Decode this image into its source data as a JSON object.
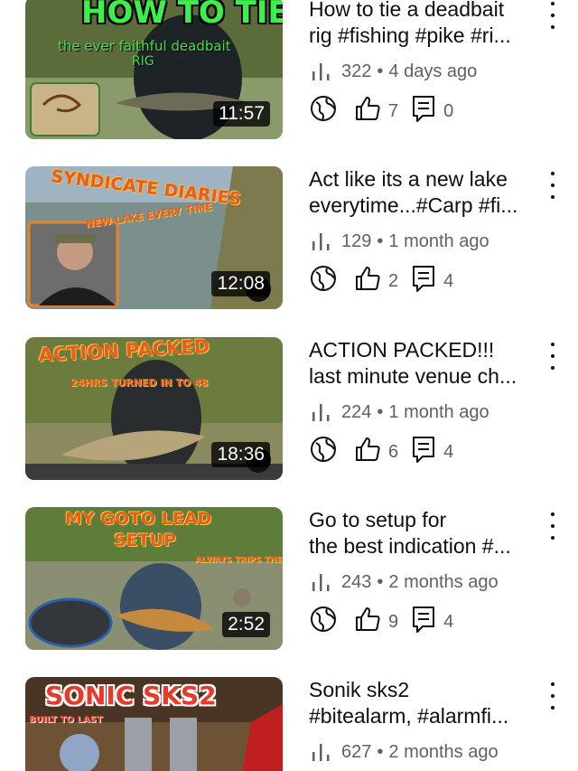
{
  "videos": [
    {
      "thumb_text": "HOW TO TIE...",
      "thumb_subtext": "the ever faithful deadbait",
      "thumb_subtext2": "RIG",
      "duration": "11:57",
      "title_line1": "How to tie a deadbait",
      "title_line2": "rig #fishing #pike #ri...",
      "views": "322",
      "age": "4 days ago",
      "likes": "7",
      "comments": "0"
    },
    {
      "thumb_text": "SYNDICATE DIARIES",
      "thumb_subtext": "NEW LAKE EVERY TIME",
      "duration": "12:08",
      "title_line1": "Act like its a new lake",
      "title_line2": "everytime...#Carp #fi...",
      "views": "129",
      "age": "1 month ago",
      "likes": "2",
      "comments": "4"
    },
    {
      "thumb_text": "ACTION PACKED",
      "thumb_subtext": "24HRS TURNED IN TO 48",
      "duration": "18:36",
      "title_line1": "ACTION PACKED!!!",
      "title_line2": "last minute venue ch...",
      "views": "224",
      "age": "1 month ago",
      "likes": "6",
      "comments": "4"
    },
    {
      "thumb_text": "MY GOTO LEAD",
      "thumb_text2": "SETUP",
      "thumb_subtext": "ALWAYS TRIPS THEM UP",
      "duration": "2:52",
      "title_line1": "Go to setup for",
      "title_line2": "the best indication #...",
      "views": "243",
      "age": "2 months ago",
      "likes": "9",
      "comments": "4"
    },
    {
      "thumb_text": "SONIC SKS2",
      "thumb_subtext": "BUILT TO LAST",
      "title_line1": "Sonik sks2",
      "title_line2": "#bitealarm, #alarmfi...",
      "views": "627",
      "age": "2 months ago"
    }
  ],
  "separator": "•",
  "icons": {
    "views": "bar-chart-icon",
    "visibility": "globe-icon",
    "likes": "thumbs-up-icon",
    "comments": "comment-icon",
    "more": "more-vertical-icon"
  },
  "colors": {
    "text_primary": "#0f0f0f",
    "text_secondary": "#606060",
    "duration_bg": "#000000"
  }
}
